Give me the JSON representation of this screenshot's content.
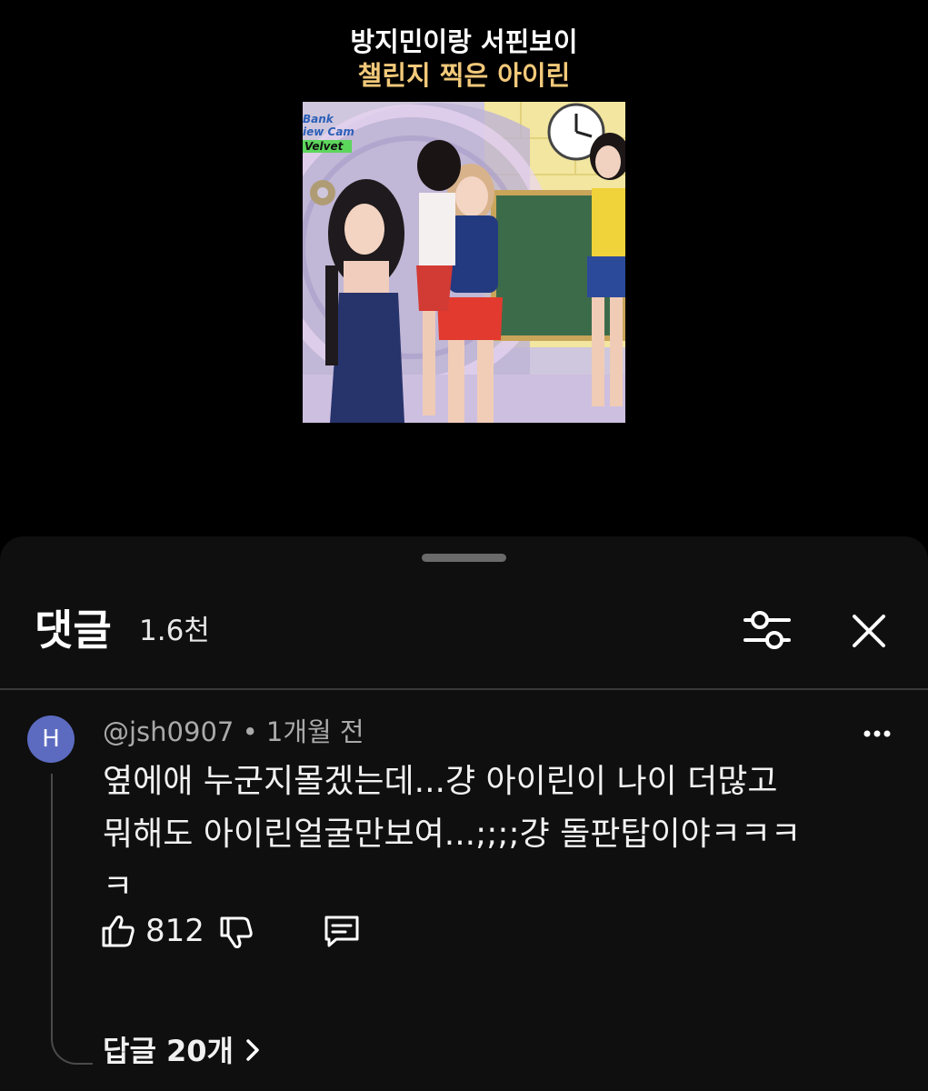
{
  "video": {
    "title_line1": "방지민이랑 서핀보이",
    "title_line2": "챌린지 찍은 아이린",
    "thumbnail": {
      "caption_line1": "Bank",
      "caption_line2": "iew Cam",
      "caption_line3": "Velvet"
    }
  },
  "comments_sheet": {
    "title": "댓글",
    "count": "1.6천",
    "filter_icon": "sliders-icon",
    "close_icon": "close-icon",
    "comment": {
      "avatar_letter": "H",
      "avatar_color": "#5c6bc0",
      "author": "@jsh0907",
      "separator": " • ",
      "time": "1개월 전",
      "text": "옆에애 누군지몰겠는데...걍 아이린이 나이 더많고\n뭐해도 아이린얼굴만보여...;;;;걍 돌판탑이야ㅋㅋㅋ\nㅋ",
      "like_count": "812",
      "replies_label": "답글 20개"
    }
  },
  "colors": {
    "background": "#000000",
    "sheet": "#0f0f0f",
    "title_accent": "#f2c97a",
    "meta_text": "#aaaaaa"
  }
}
